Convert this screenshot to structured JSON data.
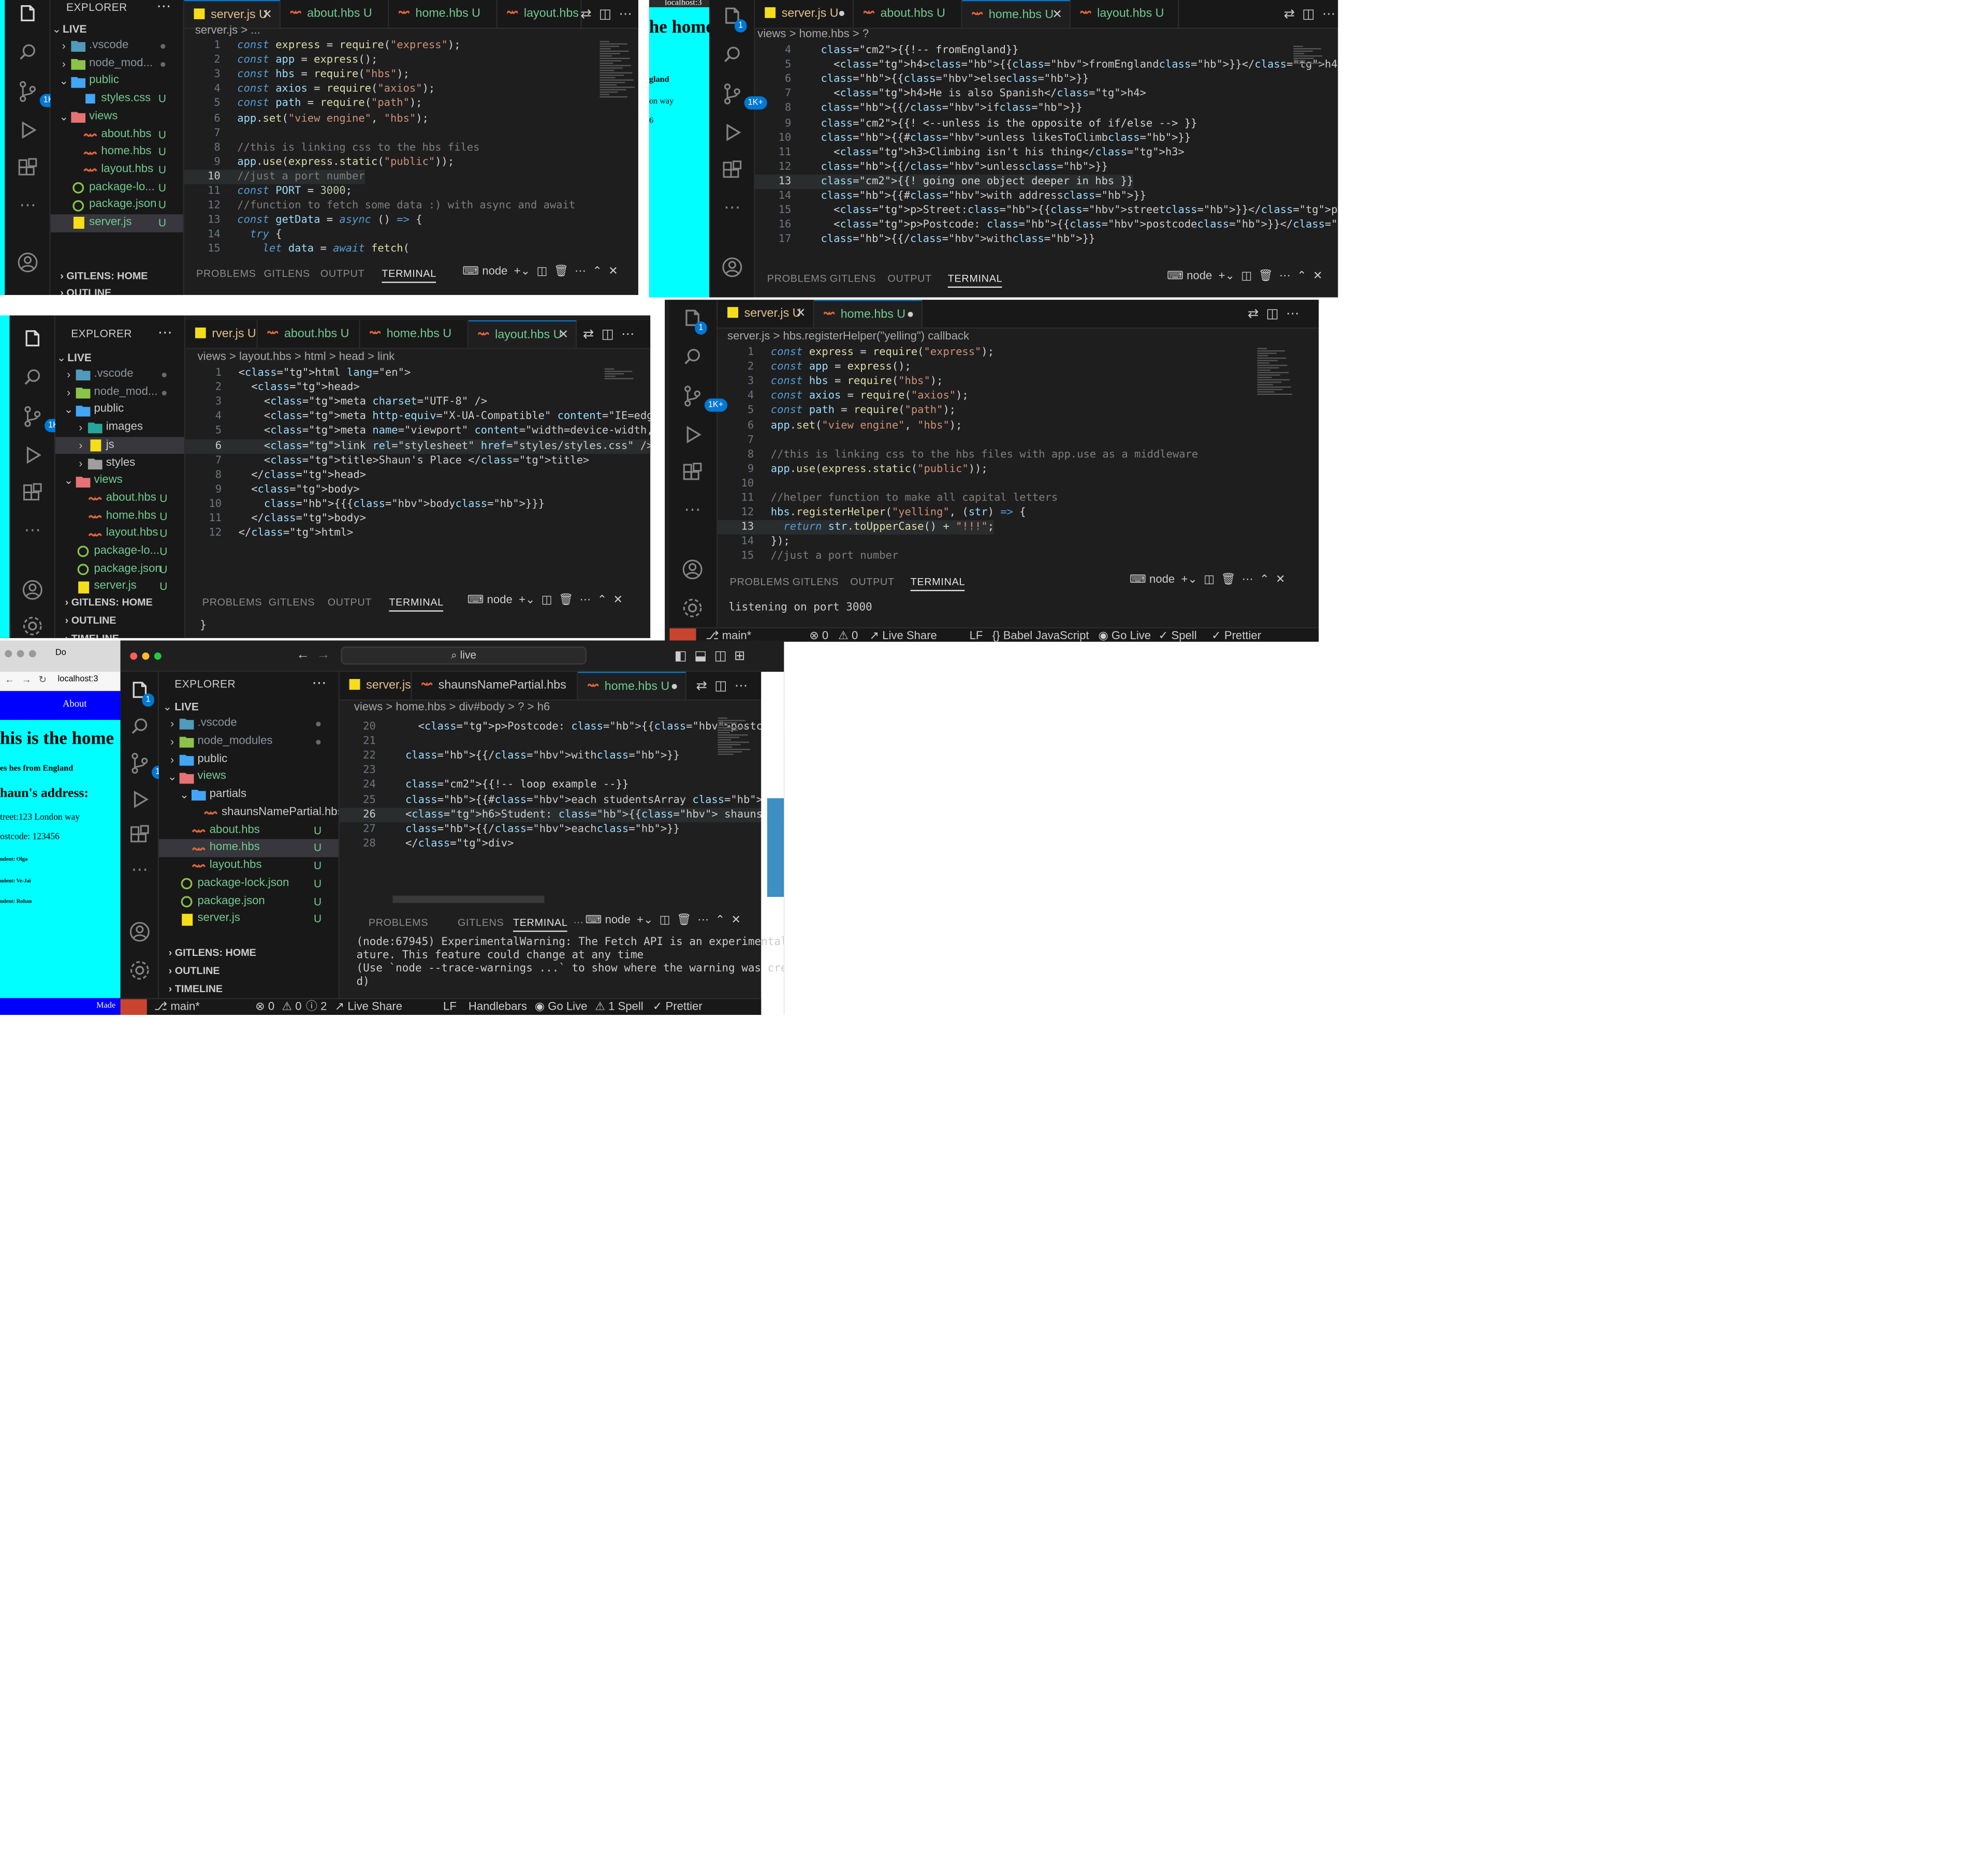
{
  "activity": {
    "badge": "1K+",
    "badge_small": "1"
  },
  "explorer": {
    "title": "EXPLORER",
    "root": "LIVE",
    "gitlens": "GITLENS: HOME",
    "outline": "OUTLINE",
    "timeline": "TIMELINE"
  },
  "p1": {
    "tree": [
      ".vscode",
      "node_mod...",
      "public",
      "styles.css",
      "views",
      "about.hbs",
      "home.hbs",
      "layout.hbs",
      "package-lo...",
      "package.json",
      "server.js"
    ],
    "tabs": [
      "server.js U",
      "about.hbs U",
      "home.hbs U",
      "layout.hbs"
    ],
    "crumb": "server.js > ...",
    "lines": [
      "1",
      "2",
      "3",
      "4",
      "5",
      "6",
      "7",
      "8",
      "9",
      "10",
      "11",
      "12",
      "13",
      "14",
      "15"
    ],
    "code": [
      "const express = require(\"express\");",
      "const app = express();",
      "const hbs = require(\"hbs\");",
      "const axios = require(\"axios\");",
      "const path = require(\"path\");",
      "app.set(\"view engine\", \"hbs\");",
      "",
      "//this is linking css to the hbs files",
      "app.use(express.static(\"public\"));",
      "//just a port number",
      "const PORT = 3000;",
      "//function to fetch some data :) with async and await",
      "const getData = async () => {",
      "  try {",
      "    let data = await fetch("
    ],
    "panel_tabs": [
      "PROBLEMS",
      "GITLENS",
      "OUTPUT",
      "TERMINAL"
    ],
    "term_shell": "node"
  },
  "p2": {
    "browser_tab": "localhost:3",
    "browser_heading": "he home",
    "browser_line1": "gland",
    "browser_line2": "on way",
    "browser_line3": "6",
    "tabs": [
      "server.js U",
      "about.hbs U",
      "home.hbs U",
      "layout.hbs U"
    ],
    "crumb": "views > home.hbs > ?",
    "lines": [
      "4",
      "5",
      "6",
      "7",
      "8",
      "9",
      "10",
      "11",
      "12",
      "13",
      "14",
      "15",
      "16",
      "17"
    ],
    "code": [
      "  {{!-- fromEngland}}",
      "    <h4>{{fromEngland}}</h4>",
      "  {{else}}",
      "    <h4>He is also Spanish</h4>",
      "  {{/if}}",
      "  {{! <--unless is the opposite of if/else --> }}",
      "  {{#unless likesToClimb}}",
      "    <h3>Climbing isn't his thing</h3>",
      "  {{/unless}}",
      "  {{! going one object deeper in hbs }}",
      "  {{#with address}}",
      "    <p>Street:{{street}}</p>",
      "    <p>Postcode: {{postcode}}</p>",
      "  {{/with}}"
    ],
    "panel_tabs": [
      "PROBLEMS",
      "GITLENS",
      "OUTPUT",
      "TERMINAL"
    ],
    "term_shell": "node"
  },
  "p3": {
    "tree": [
      ".vscode",
      "node_mod...",
      "public",
      "images",
      "js",
      "styles",
      "views",
      "about.hbs",
      "home.hbs",
      "layout.hbs",
      "package-lo...",
      "package.json",
      "server.js"
    ],
    "tabs": [
      "rver.js U",
      "about.hbs U",
      "home.hbs U",
      "layout.hbs U"
    ],
    "crumb": "views > layout.hbs > html > head > link",
    "lines": [
      "1",
      "2",
      "3",
      "4",
      "5",
      "6",
      "7",
      "8",
      "9",
      "10",
      "11",
      "12"
    ],
    "code": [
      "<html lang=\"en\">",
      "  <head>",
      "    <meta charset=\"UTF-8\" />",
      "    <meta http-equiv=\"X-UA-Compatible\" content=\"IE=edge\" />",
      "    <meta name=\"viewport\" content=\"width=device-width, initial",
      "    <link rel=\"stylesheet\" href=\"styles/styles.css\" />",
      "    <title>Shaun's Place </title>",
      "  </head>",
      "  <body>",
      "    {{{body}}}",
      "  </body>",
      "</html>"
    ],
    "panel_tabs": [
      "PROBLEMS",
      "GITLENS",
      "OUTPUT",
      "TERMINAL"
    ],
    "term_shell": "node",
    "term_text": "}"
  },
  "p4": {
    "tabs": [
      "server.js U",
      "home.hbs U"
    ],
    "crumb": "server.js > hbs.registerHelper(\"yelling\") callback",
    "lines": [
      "1",
      "2",
      "3",
      "4",
      "5",
      "6",
      "7",
      "8",
      "9",
      "10",
      "11",
      "12",
      "13",
      "14",
      "15"
    ],
    "code": [
      "const express = require(\"express\");",
      "const app = express();",
      "const hbs = require(\"hbs\");",
      "const axios = require(\"axios\");",
      "const path = require(\"path\");",
      "app.set(\"view engine\", \"hbs\");",
      "",
      "//this is linking css to the hbs files with app.use as a middleware",
      "app.use(express.static(\"public\"));",
      "",
      "//helper function to make all capital letters",
      "hbs.registerHelper(\"yelling\", (str) => {",
      "  return str.toUpperCase() + \"!!!\";",
      "});",
      "//just a port number"
    ],
    "panel_tabs": [
      "PROBLEMS",
      "GITLENS",
      "OUTPUT",
      "TERMINAL"
    ],
    "term_shell": "node",
    "term_text": "listening on port 3000",
    "status": [
      "main*",
      "0",
      "0",
      "Live Share",
      "LF",
      "{} Babel JavaScript",
      "Go Live",
      "Spell",
      "Prettier"
    ]
  },
  "p5": {
    "browser_tab": "Do",
    "browser_url": "localhost:3",
    "browser_nav": "About",
    "browser_h1": "his is the home",
    "browser_h4": "es hes from England",
    "browser_h2": "haun's address:",
    "browser_street": "treet:123 London way",
    "browser_postcode": "ostcode: 123456",
    "browser_students": [
      "udent: Olga",
      "udent: Ve-Jai",
      "udent: Rohan"
    ],
    "browser_footer": "Made",
    "search": "live",
    "tree": [
      ".vscode",
      "node_modules",
      "public",
      "views",
      "partials",
      "shaunsNamePartial.hbs",
      "about.hbs",
      "home.hbs",
      "layout.hbs",
      "package-lock.json",
      "package.json",
      "server.js"
    ],
    "tabs": [
      "server.js U",
      "shaunsNamePartial.hbs",
      "home.hbs U"
    ],
    "crumb": "views > home.hbs > div#body > ? > h6",
    "lines": [
      "20",
      "21",
      "22",
      "23",
      "24",
      "25",
      "26",
      "27",
      "28"
    ],
    "code": [
      "    <p>Postcode: {{postcode}}</p>",
      "",
      "  {{/with}}",
      "",
      "  {{!-- loop example --}}",
      "  {{#each studentsArray }}",
      "  <h6>Student: {{ shaunsNamePartial this}}</h6>",
      "  {{/each}}",
      "  </div>"
    ],
    "panel_tabs": [
      "PROBLEMS",
      "GITLENS",
      "TERMINAL"
    ],
    "problems_count": "2",
    "term_shell": "node",
    "term_lines": [
      "(node:67945) ExperimentalWarning: The Fetch API is an experimental fe",
      "ature. This feature could change at any time",
      "(Use `node --trace-warnings ...` to show where the warning was create",
      "d)"
    ],
    "status": [
      "main*",
      "0",
      "0",
      "2",
      "Live Share",
      "LF",
      "Handlebars",
      "Go Live",
      "1 Spell",
      "Prettier"
    ]
  }
}
